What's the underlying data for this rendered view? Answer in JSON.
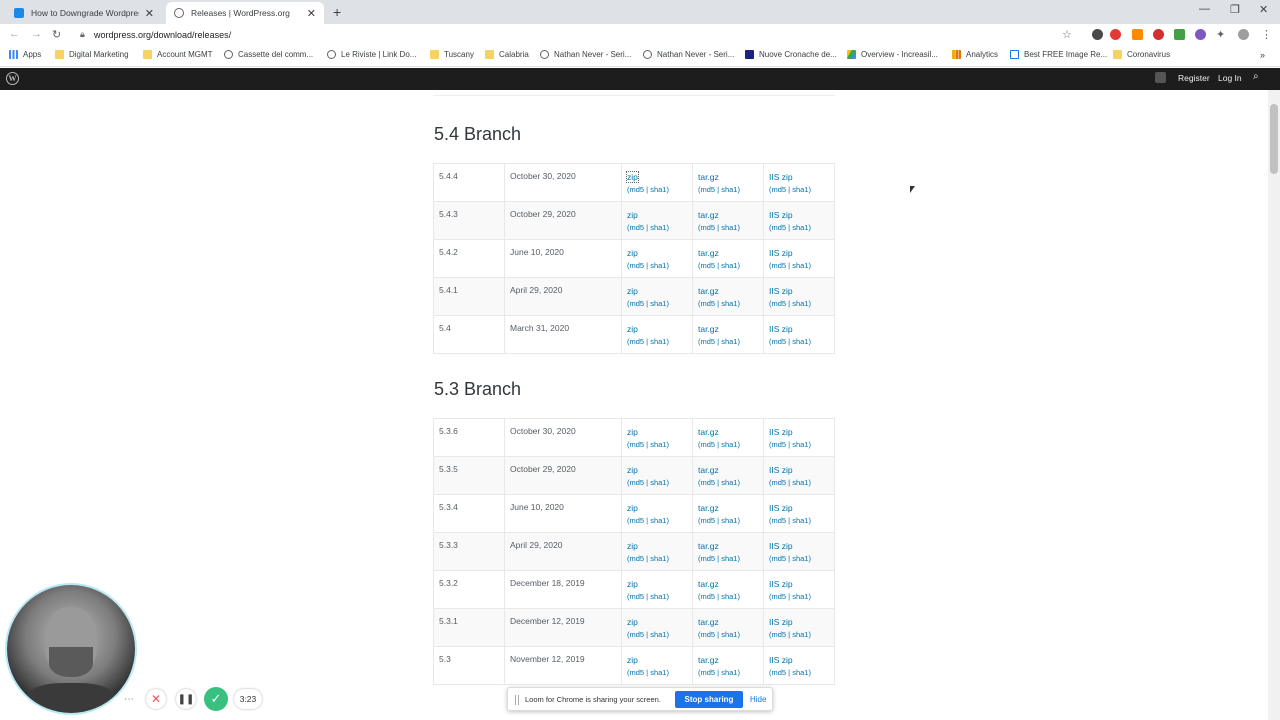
{
  "browser": {
    "tabs": [
      {
        "title": "How to Downgrade Wordpress (",
        "active": false,
        "favicon_color": "#1e88e5"
      },
      {
        "title": "Releases | WordPress.org",
        "active": true,
        "favicon_color": "#5f6368"
      }
    ],
    "url": "wordpress.org/download/releases/",
    "bookmarks": [
      {
        "label": "Apps",
        "icon": "apps-grid-icon"
      },
      {
        "label": "Digital Marketing",
        "icon": "folder-icon"
      },
      {
        "label": "Account MGMT",
        "icon": "folder-icon"
      },
      {
        "label": "Cassette del comm...",
        "icon": "globe-icon"
      },
      {
        "label": "Le Riviste | Link Do...",
        "icon": "globe-icon"
      },
      {
        "label": "Tuscany",
        "icon": "folder-icon"
      },
      {
        "label": "Calabria",
        "icon": "folder-icon"
      },
      {
        "label": "Nathan Never - Seri...",
        "icon": "globe-icon"
      },
      {
        "label": "Nathan Never - Seri...",
        "icon": "globe-icon"
      },
      {
        "label": "Nuove Cronache de...",
        "icon": "n-logo-icon"
      },
      {
        "label": "Overview - Increasil...",
        "icon": "drive-icon"
      },
      {
        "label": "Analytics",
        "icon": "analytics-icon"
      },
      {
        "label": "Best FREE Image Re...",
        "icon": "page-icon"
      },
      {
        "label": "Coronavirus",
        "icon": "folder-icon"
      }
    ]
  },
  "wpbar": {
    "register": "Register",
    "login": "Log In"
  },
  "branches": [
    {
      "title": "5.4 Branch",
      "rows": [
        {
          "version": "5.4.4",
          "date": "October 30, 2020"
        },
        {
          "version": "5.4.3",
          "date": "October 29, 2020"
        },
        {
          "version": "5.4.2",
          "date": "June 10, 2020"
        },
        {
          "version": "5.4.1",
          "date": "April 29, 2020"
        },
        {
          "version": "5.4",
          "date": "March 31, 2020"
        }
      ]
    },
    {
      "title": "5.3 Branch",
      "rows": [
        {
          "version": "5.3.6",
          "date": "October 30, 2020"
        },
        {
          "version": "5.3.5",
          "date": "October 29, 2020"
        },
        {
          "version": "5.3.4",
          "date": "June 10, 2020"
        },
        {
          "version": "5.3.3",
          "date": "April 29, 2020"
        },
        {
          "version": "5.3.2",
          "date": "December 18, 2019"
        },
        {
          "version": "5.3.1",
          "date": "December 12, 2019"
        },
        {
          "version": "5.3",
          "date": "November 12, 2019"
        }
      ]
    }
  ],
  "download_labels": {
    "zip": "zip",
    "targz": "tar.gz",
    "iis": "IIS zip",
    "md5": "md5",
    "sha1": "sha1"
  },
  "loom": {
    "timer": "3:23",
    "share_message": "Loom for Chrome is sharing your screen.",
    "stop_label": "Stop sharing",
    "hide_label": "Hide"
  }
}
